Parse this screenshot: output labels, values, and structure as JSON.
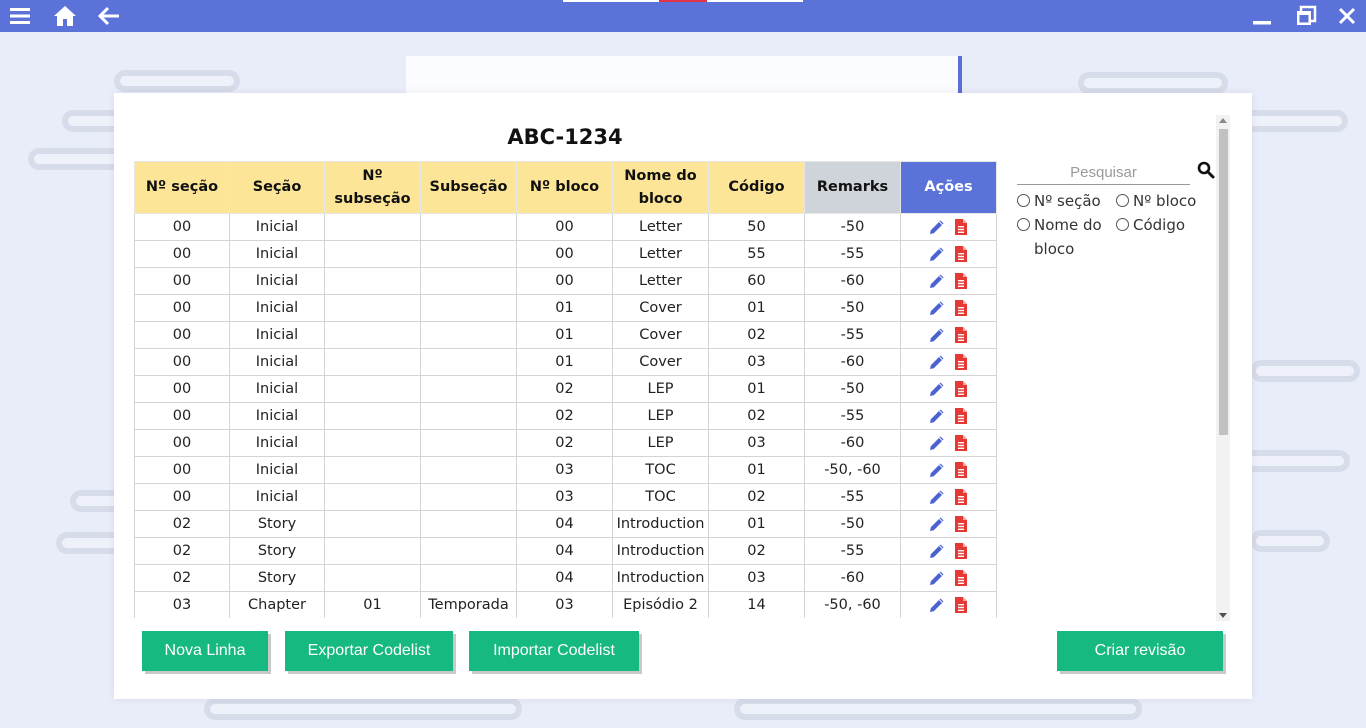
{
  "colors": {
    "titlebar": "#5b72d9",
    "header_yellow": "#fce596",
    "header_gray": "#cfd3da",
    "header_blue": "#5b72d9",
    "button_green": "#16b97f",
    "edit_icon": "#4b63d0",
    "pdf_icon": "#e53935"
  },
  "titlebar": {
    "icons": [
      "menu-icon",
      "home-icon",
      "back-arrow-icon",
      "minimize-icon",
      "restore-icon",
      "close-icon"
    ]
  },
  "document": {
    "title": "ABC-1234"
  },
  "table": {
    "headers": {
      "n_secao": "Nº seção",
      "secao": "Seção",
      "n_subsecao": "Nº subseção",
      "subsecao": "Subseção",
      "n_bloco": "Nº bloco",
      "nome_bloco": "Nome do bloco",
      "codigo": "Código",
      "remarks": "Remarks",
      "acoes": "Ações"
    },
    "rows": [
      [
        "00",
        "Inicial",
        "",
        "",
        "00",
        "Letter",
        "50",
        "-50"
      ],
      [
        "00",
        "Inicial",
        "",
        "",
        "00",
        "Letter",
        "55",
        "-55"
      ],
      [
        "00",
        "Inicial",
        "",
        "",
        "00",
        "Letter",
        "60",
        "-60"
      ],
      [
        "00",
        "Inicial",
        "",
        "",
        "01",
        "Cover",
        "01",
        "-50"
      ],
      [
        "00",
        "Inicial",
        "",
        "",
        "01",
        "Cover",
        "02",
        "-55"
      ],
      [
        "00",
        "Inicial",
        "",
        "",
        "01",
        "Cover",
        "03",
        "-60"
      ],
      [
        "00",
        "Inicial",
        "",
        "",
        "02",
        "LEP",
        "01",
        "-50"
      ],
      [
        "00",
        "Inicial",
        "",
        "",
        "02",
        "LEP",
        "02",
        "-55"
      ],
      [
        "00",
        "Inicial",
        "",
        "",
        "02",
        "LEP",
        "03",
        "-60"
      ],
      [
        "00",
        "Inicial",
        "",
        "",
        "03",
        "TOC",
        "01",
        "-50, -60"
      ],
      [
        "00",
        "Inicial",
        "",
        "",
        "03",
        "TOC",
        "02",
        "-55"
      ],
      [
        "02",
        "Story",
        "",
        "",
        "04",
        "Introduction",
        "01",
        "-50"
      ],
      [
        "02",
        "Story",
        "",
        "",
        "04",
        "Introduction",
        "02",
        "-55"
      ],
      [
        "02",
        "Story",
        "",
        "",
        "04",
        "Introduction",
        "03",
        "-60"
      ],
      [
        "03",
        "Chapter",
        "01",
        "Temporada",
        "03",
        "Episódio 2",
        "14",
        "-50, -60"
      ]
    ],
    "row_actions": [
      "pencil-icon",
      "pdf-file-icon"
    ]
  },
  "search": {
    "placeholder": "Pesquisar",
    "value": "",
    "icon": "search-icon",
    "filters": {
      "n_secao": "Nº seção",
      "n_bloco": "Nº bloco",
      "nome_bloco": "Nome do bloco",
      "codigo": "Código"
    }
  },
  "buttons": {
    "nova_linha": "Nova Linha",
    "exportar": "Exportar Codelist",
    "importar": "Importar Codelist",
    "criar_revisao": "Criar revisão"
  }
}
